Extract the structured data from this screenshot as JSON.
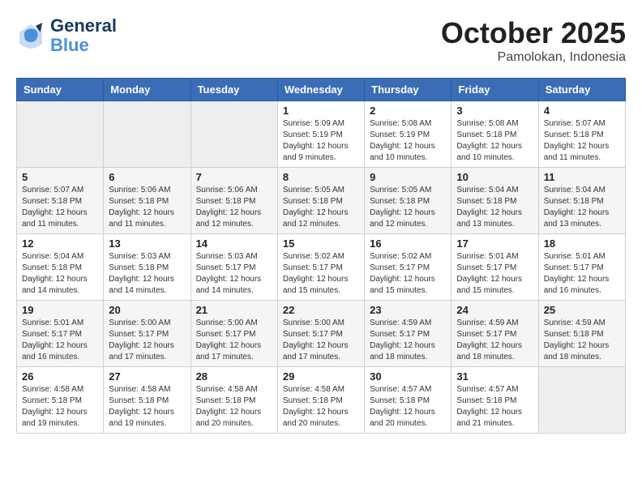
{
  "header": {
    "logo_line1": "General",
    "logo_line2": "Blue",
    "month": "October 2025",
    "location": "Pamolokan, Indonesia"
  },
  "weekdays": [
    "Sunday",
    "Monday",
    "Tuesday",
    "Wednesday",
    "Thursday",
    "Friday",
    "Saturday"
  ],
  "weeks": [
    [
      {
        "day": "",
        "info": ""
      },
      {
        "day": "",
        "info": ""
      },
      {
        "day": "",
        "info": ""
      },
      {
        "day": "1",
        "info": "Sunrise: 5:09 AM\nSunset: 5:19 PM\nDaylight: 12 hours\nand 9 minutes."
      },
      {
        "day": "2",
        "info": "Sunrise: 5:08 AM\nSunset: 5:19 PM\nDaylight: 12 hours\nand 10 minutes."
      },
      {
        "day": "3",
        "info": "Sunrise: 5:08 AM\nSunset: 5:18 PM\nDaylight: 12 hours\nand 10 minutes."
      },
      {
        "day": "4",
        "info": "Sunrise: 5:07 AM\nSunset: 5:18 PM\nDaylight: 12 hours\nand 11 minutes."
      }
    ],
    [
      {
        "day": "5",
        "info": "Sunrise: 5:07 AM\nSunset: 5:18 PM\nDaylight: 12 hours\nand 11 minutes."
      },
      {
        "day": "6",
        "info": "Sunrise: 5:06 AM\nSunset: 5:18 PM\nDaylight: 12 hours\nand 11 minutes."
      },
      {
        "day": "7",
        "info": "Sunrise: 5:06 AM\nSunset: 5:18 PM\nDaylight: 12 hours\nand 12 minutes."
      },
      {
        "day": "8",
        "info": "Sunrise: 5:05 AM\nSunset: 5:18 PM\nDaylight: 12 hours\nand 12 minutes."
      },
      {
        "day": "9",
        "info": "Sunrise: 5:05 AM\nSunset: 5:18 PM\nDaylight: 12 hours\nand 12 minutes."
      },
      {
        "day": "10",
        "info": "Sunrise: 5:04 AM\nSunset: 5:18 PM\nDaylight: 12 hours\nand 13 minutes."
      },
      {
        "day": "11",
        "info": "Sunrise: 5:04 AM\nSunset: 5:18 PM\nDaylight: 12 hours\nand 13 minutes."
      }
    ],
    [
      {
        "day": "12",
        "info": "Sunrise: 5:04 AM\nSunset: 5:18 PM\nDaylight: 12 hours\nand 14 minutes."
      },
      {
        "day": "13",
        "info": "Sunrise: 5:03 AM\nSunset: 5:18 PM\nDaylight: 12 hours\nand 14 minutes."
      },
      {
        "day": "14",
        "info": "Sunrise: 5:03 AM\nSunset: 5:17 PM\nDaylight: 12 hours\nand 14 minutes."
      },
      {
        "day": "15",
        "info": "Sunrise: 5:02 AM\nSunset: 5:17 PM\nDaylight: 12 hours\nand 15 minutes."
      },
      {
        "day": "16",
        "info": "Sunrise: 5:02 AM\nSunset: 5:17 PM\nDaylight: 12 hours\nand 15 minutes."
      },
      {
        "day": "17",
        "info": "Sunrise: 5:01 AM\nSunset: 5:17 PM\nDaylight: 12 hours\nand 15 minutes."
      },
      {
        "day": "18",
        "info": "Sunrise: 5:01 AM\nSunset: 5:17 PM\nDaylight: 12 hours\nand 16 minutes."
      }
    ],
    [
      {
        "day": "19",
        "info": "Sunrise: 5:01 AM\nSunset: 5:17 PM\nDaylight: 12 hours\nand 16 minutes."
      },
      {
        "day": "20",
        "info": "Sunrise: 5:00 AM\nSunset: 5:17 PM\nDaylight: 12 hours\nand 17 minutes."
      },
      {
        "day": "21",
        "info": "Sunrise: 5:00 AM\nSunset: 5:17 PM\nDaylight: 12 hours\nand 17 minutes."
      },
      {
        "day": "22",
        "info": "Sunrise: 5:00 AM\nSunset: 5:17 PM\nDaylight: 12 hours\nand 17 minutes."
      },
      {
        "day": "23",
        "info": "Sunrise: 4:59 AM\nSunset: 5:17 PM\nDaylight: 12 hours\nand 18 minutes."
      },
      {
        "day": "24",
        "info": "Sunrise: 4:59 AM\nSunset: 5:17 PM\nDaylight: 12 hours\nand 18 minutes."
      },
      {
        "day": "25",
        "info": "Sunrise: 4:59 AM\nSunset: 5:18 PM\nDaylight: 12 hours\nand 18 minutes."
      }
    ],
    [
      {
        "day": "26",
        "info": "Sunrise: 4:58 AM\nSunset: 5:18 PM\nDaylight: 12 hours\nand 19 minutes."
      },
      {
        "day": "27",
        "info": "Sunrise: 4:58 AM\nSunset: 5:18 PM\nDaylight: 12 hours\nand 19 minutes."
      },
      {
        "day": "28",
        "info": "Sunrise: 4:58 AM\nSunset: 5:18 PM\nDaylight: 12 hours\nand 20 minutes."
      },
      {
        "day": "29",
        "info": "Sunrise: 4:58 AM\nSunset: 5:18 PM\nDaylight: 12 hours\nand 20 minutes."
      },
      {
        "day": "30",
        "info": "Sunrise: 4:57 AM\nSunset: 5:18 PM\nDaylight: 12 hours\nand 20 minutes."
      },
      {
        "day": "31",
        "info": "Sunrise: 4:57 AM\nSunset: 5:18 PM\nDaylight: 12 hours\nand 21 minutes."
      },
      {
        "day": "",
        "info": ""
      }
    ]
  ]
}
